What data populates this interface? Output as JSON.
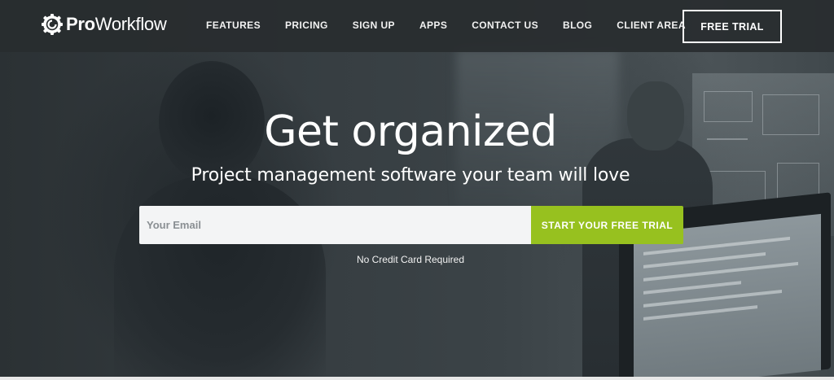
{
  "brand": {
    "logo_bold": "Pro",
    "logo_regular": "Workflow",
    "accent_color": "#97c11f"
  },
  "nav": {
    "links": [
      "FEATURES",
      "PRICING",
      "SIGN UP",
      "APPS",
      "CONTACT US",
      "BLOG",
      "CLIENT AREA"
    ],
    "free_trial_label": "FREE TRIAL"
  },
  "hero": {
    "headline": "Get organized",
    "subheadline": "Project management software your team will love",
    "email_placeholder": "Your Email",
    "email_value": "",
    "cta_label": "START YOUR FREE TRIAL",
    "note": "No Credit Card Required"
  }
}
